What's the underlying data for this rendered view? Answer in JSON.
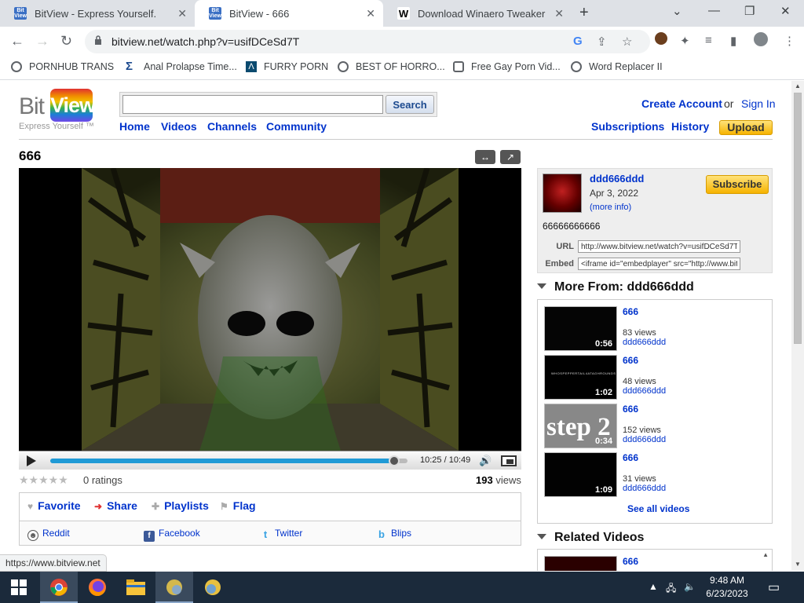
{
  "browser": {
    "tabs": [
      {
        "title": "BitView - Express Yourself.",
        "favicon": "bitview-favicon",
        "active": false
      },
      {
        "title": "BitView - 666",
        "favicon": "bitview-favicon",
        "active": true
      },
      {
        "title": "Download Winaero Tweaker",
        "favicon": "winaero-favicon",
        "active": false
      }
    ],
    "favicon_bitview_text": "Bit View",
    "favicon_winaero_text": "W",
    "url": "bitview.net/watch.php?v=usifDCeSd7T",
    "bookmarks": [
      {
        "label": "PORNHUB TRANS",
        "icon": "globe-icon"
      },
      {
        "label": "Anal Prolapse Time...",
        "icon": "sigma-icon"
      },
      {
        "label": "FURRY PORN",
        "icon": "triangle-icon"
      },
      {
        "label": "BEST OF HORRO...",
        "icon": "globe-icon"
      },
      {
        "label": "Free Gay Porn Vid...",
        "icon": "puzzle-icon"
      },
      {
        "label": "Word Replacer II",
        "icon": "globe-icon"
      }
    ]
  },
  "site": {
    "logo_bit": "Bit",
    "logo_view": "View",
    "tagline": "Express Yourself ™",
    "search_placeholder": "",
    "search_button": "Search",
    "nav": [
      "Home",
      "Videos",
      "Channels",
      "Community"
    ],
    "create_account": "Create Account",
    "or": "or",
    "sign_in": "Sign In",
    "subscriptions": "Subscriptions",
    "history": "History",
    "upload": "Upload"
  },
  "video": {
    "title": "666",
    "time_current": "10:25",
    "time_separator": "/",
    "time_total": "10:49",
    "progress_fraction": 0.962,
    "stars": "★★★★★",
    "ratings": "0 ratings",
    "views_count": "193",
    "views_label": "views",
    "actions": [
      "Favorite",
      "Share",
      "Playlists",
      "Flag"
    ],
    "share_links": [
      "Reddit",
      "Facebook",
      "Twitter",
      "Blips"
    ]
  },
  "uploader": {
    "name": "ddd666ddd",
    "date": "Apr 3, 2022",
    "more_info": "(more info)",
    "subscribe": "Subscribe",
    "description": "66666666666",
    "url_label": "URL",
    "url_value": "http://www.bitview.net/watch?v=usifDCeSd7T",
    "embed_label": "Embed",
    "embed_value": "<iframe id=\"embedplayer\" src=\"http://www.bit"
  },
  "more_from": {
    "heading": "More From: ddd666ddd",
    "videos": [
      {
        "title": "666",
        "views": "83 views",
        "user": "ddd666ddd",
        "duration": "0:56"
      },
      {
        "title": "666",
        "views": "48 views",
        "user": "ddd666ddd",
        "duration": "1:02"
      },
      {
        "title": "666",
        "views": "152 views",
        "user": "ddd666ddd",
        "duration": "0:34"
      },
      {
        "title": "666",
        "views": "31 views",
        "user": "ddd666ddd",
        "duration": "1:09"
      }
    ],
    "thumb2_text": "WHOSPEPPERTAIL4ATAGHROUNDS",
    "thumb3_text": "step 2",
    "see_all": "See all videos"
  },
  "related": {
    "heading": "Related Videos",
    "first_title": "666"
  },
  "status_url": "https://www.bitview.net",
  "taskbar": {
    "time": "9:48 AM",
    "date": "6/23/2023"
  }
}
